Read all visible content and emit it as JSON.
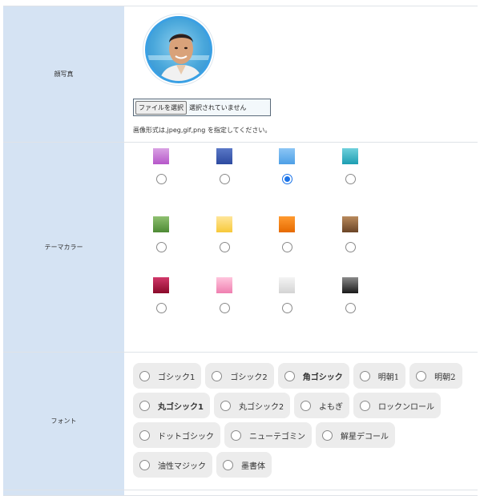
{
  "photo_row": {
    "label": "顔写真",
    "file_button": "ファイルを選択",
    "file_status": "選択されていません",
    "hint": "画像形式は,jpeg,gif,png を指定してください。"
  },
  "theme_row": {
    "label": "テーマカラー",
    "swatches": [
      {
        "name": "purple",
        "colors": [
          "#b657c9",
          "#d9a2e4"
        ],
        "selected": false
      },
      {
        "name": "navy",
        "colors": [
          "#2d4aa0",
          "#5a78c7"
        ],
        "selected": false
      },
      {
        "name": "sky",
        "colors": [
          "#4d9fe6",
          "#8cc6f5"
        ],
        "selected": true
      },
      {
        "name": "teal",
        "colors": [
          "#1d9eb2",
          "#6fd0dc"
        ],
        "selected": false
      },
      {
        "name": "green",
        "colors": [
          "#4d8a34",
          "#8fc070"
        ],
        "selected": false
      },
      {
        "name": "yellow",
        "colors": [
          "#f7c93a",
          "#ffe69a"
        ],
        "selected": false
      },
      {
        "name": "orange",
        "colors": [
          "#e66a00",
          "#ff9a30"
        ],
        "selected": false
      },
      {
        "name": "brown",
        "colors": [
          "#6b4426",
          "#b98a5c"
        ],
        "selected": false
      },
      {
        "name": "crimson",
        "colors": [
          "#8a0a2a",
          "#d1386a"
        ],
        "selected": false
      },
      {
        "name": "pink",
        "colors": [
          "#ef7fb0",
          "#ffc5dd"
        ],
        "selected": false
      },
      {
        "name": "silver",
        "colors": [
          "#d4d4d4",
          "#f4f4f4"
        ],
        "selected": false
      },
      {
        "name": "black",
        "colors": [
          "#1a1a1a",
          "#8a8a8a"
        ],
        "selected": false
      }
    ]
  },
  "font_row": {
    "label": "フォント",
    "options": [
      {
        "label": "ゴシック1",
        "style": "normal"
      },
      {
        "label": "ゴシック2",
        "style": "normal"
      },
      {
        "label": "角ゴシック",
        "style": "bold"
      },
      {
        "label": "明朝1",
        "style": "serif"
      },
      {
        "label": "明朝2",
        "style": "serif"
      },
      {
        "label": "丸ゴシック1",
        "style": "bold"
      },
      {
        "label": "丸ゴシック2",
        "style": "mono"
      },
      {
        "label": "よもぎ",
        "style": "normal"
      },
      {
        "label": "ロックンロール",
        "style": "normal"
      },
      {
        "label": "ドットゴシック",
        "style": "mono"
      },
      {
        "label": "ニューテゴミン",
        "style": "normal"
      },
      {
        "label": "解星デコール",
        "style": "normal"
      },
      {
        "label": "油性マジック",
        "style": "normal"
      },
      {
        "label": "墨書体",
        "style": "serif"
      }
    ]
  }
}
